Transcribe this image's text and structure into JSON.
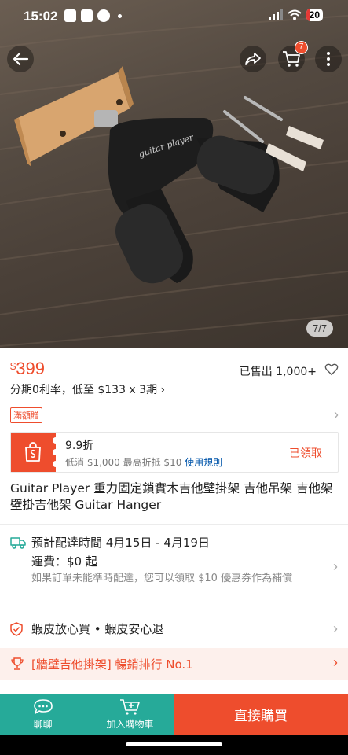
{
  "status_bar": {
    "time": "15:02",
    "battery": "20"
  },
  "gallery": {
    "counter": "7/7",
    "cart_count": "7"
  },
  "product": {
    "price_currency": "$",
    "price": "399",
    "sold": "已售出 1,000+",
    "installment": "分期0利率，低至 $133 x 3期 ›",
    "promo_tag": "滿額贈",
    "title": "Guitar Player 重力固定鎖實木吉他壁掛架 吉他吊架 吉他架 壁掛吉他架 Guitar Hanger",
    "hanger_brand_print": "guitar player"
  },
  "voucher": {
    "title": "9.9折",
    "desc_prefix": "低消 $1,000 最高折抵 $10",
    "rules_link": "使用規則",
    "claimed": "已領取"
  },
  "shipping": {
    "line1": "預計配達時間 4月15日 - 4月19日",
    "line2": "運費：$0 起",
    "note": "如果訂單未能準時配達，您可以領取 $10 優惠券作為補償"
  },
  "guarantee": {
    "text": "蝦皮放心買 • 蝦皮安心退"
  },
  "ranking": {
    "text": "[牆壁吉他掛架] 暢銷排行 No.1"
  },
  "bottom_bar": {
    "chat": "聊聊",
    "add_cart": "加入購物車",
    "buy_now": "直接購買"
  },
  "colors": {
    "accent": "#ee4d2d",
    "teal": "#26aa99"
  }
}
